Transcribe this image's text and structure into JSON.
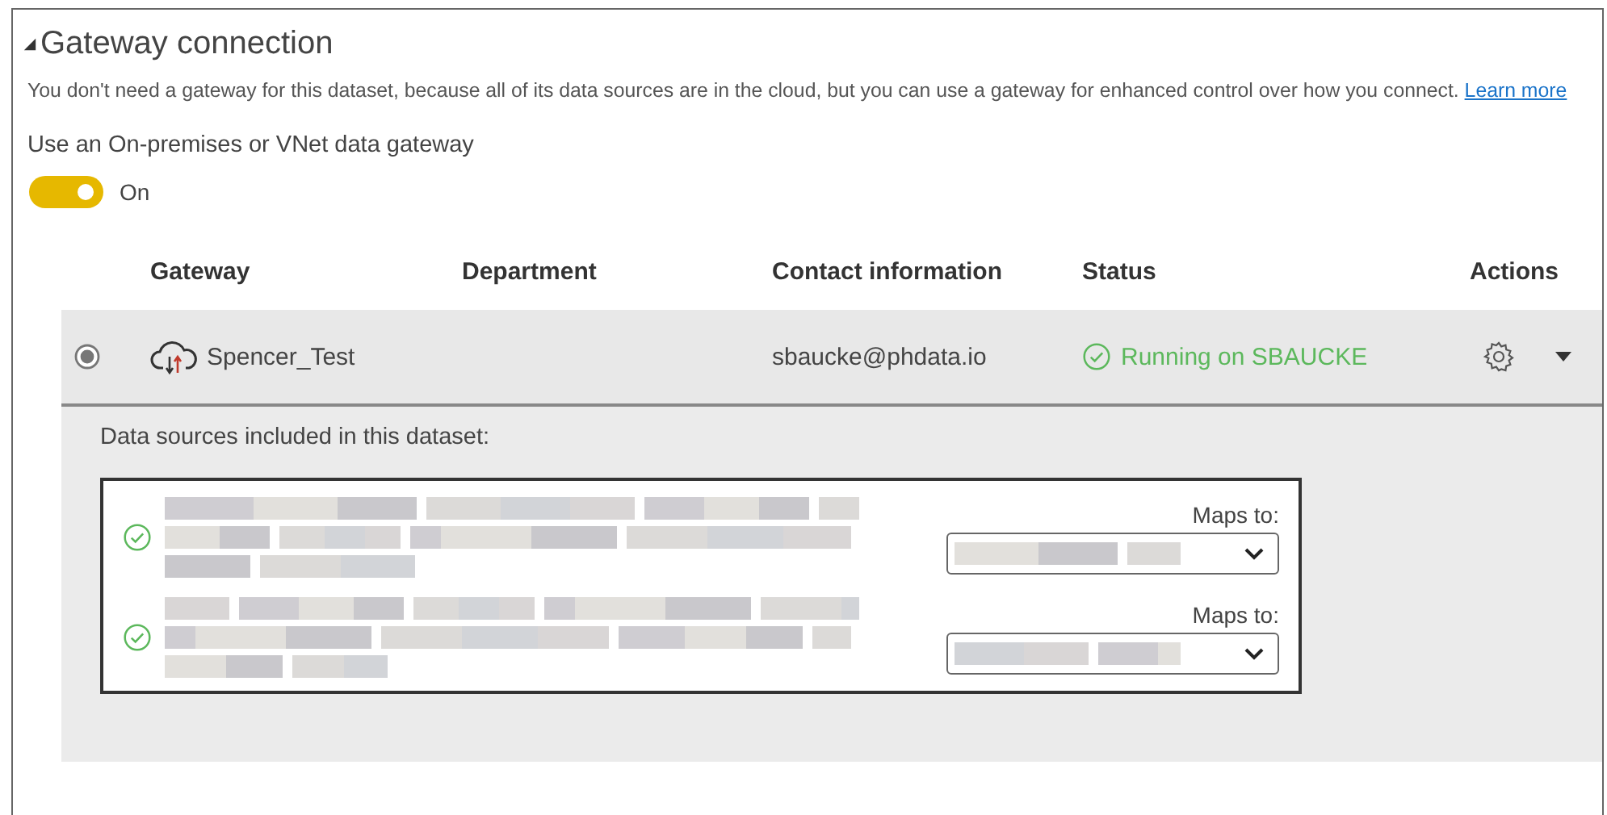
{
  "section": {
    "title": "Gateway connection",
    "expanded": true,
    "description": "You don't need a gateway for this dataset, because all of its data sources are in the cloud, but you can use a gateway for enhanced control over how you connect.",
    "link": "Learn more"
  },
  "toggle": {
    "label": "Use an On-premises or VNet data gateway",
    "on": true,
    "state_text": "On"
  },
  "table": {
    "columns": [
      "Gateway",
      "Department",
      "Contact information",
      "Status",
      "Actions"
    ],
    "rows": [
      {
        "selected": true,
        "expanded": true,
        "gateway": "Spencer_Test",
        "contact": "sbaucke@phdata.io",
        "status": "Running on SBAUCKE"
      }
    ]
  },
  "data_sources": {
    "heading": "Data sources included in this dataset:",
    "items": [
      {
        "label": "Maps to:"
      },
      {
        "label": "Maps to:"
      }
    ]
  }
}
